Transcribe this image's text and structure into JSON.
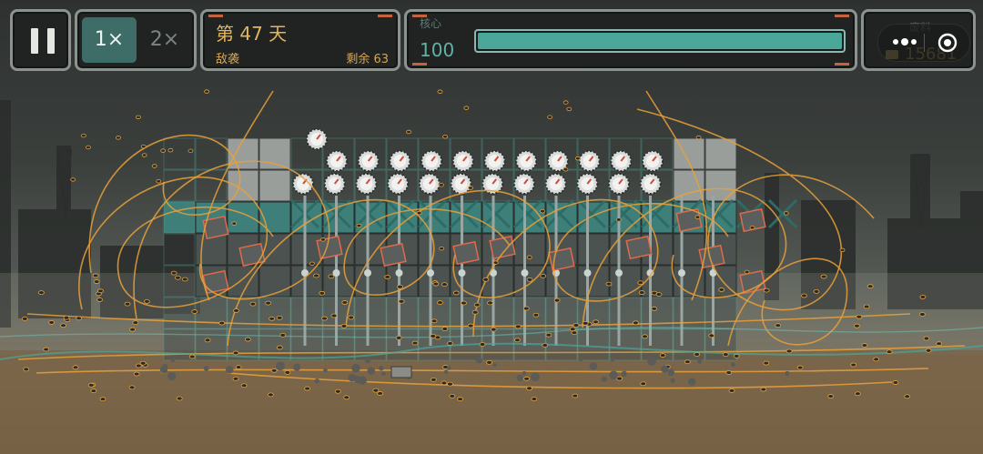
{
  "hud": {
    "pause_icon": "pause-icon",
    "speed_options": [
      "1×",
      "2×"
    ],
    "selected_speed": "1×",
    "day_title": "第 47 天",
    "wave_label": "敌袭",
    "remaining_text": "剩余 63",
    "core_label": "核心",
    "core_value": "100",
    "core_health_fraction": 1.0,
    "scrap_label": "废料",
    "scrap_value": "15681"
  },
  "capsule": {
    "more_icon": "more-dots-icon",
    "close_icon": "target-circle-icon"
  },
  "colors": {
    "accent_teal": "#4aa79a",
    "gold_text": "#e4b65a",
    "projectile_orange": "#e8a03a",
    "panel_border": "#8b938e"
  }
}
